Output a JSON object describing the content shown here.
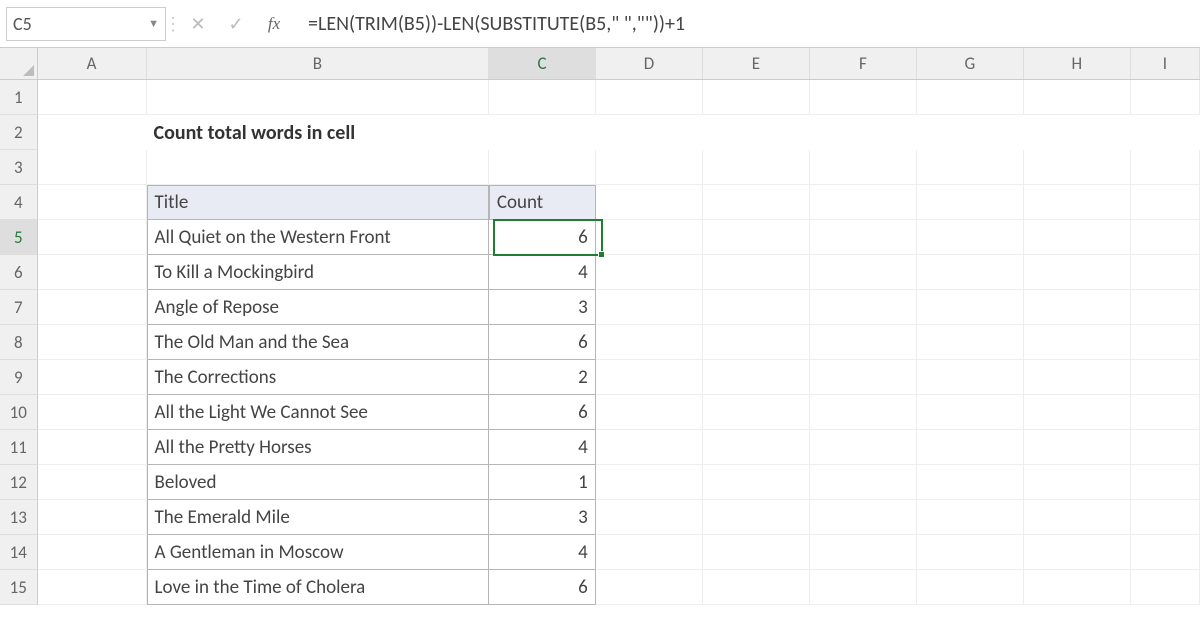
{
  "nameBox": "C5",
  "formula": "=LEN(TRIM(B5))-LEN(SUBSTITUTE(B5,\" \",\"\"))+1",
  "columns": [
    "A",
    "B",
    "C",
    "D",
    "E",
    "F",
    "G",
    "H",
    "I"
  ],
  "activeCol": "C",
  "activeRow": 5,
  "title": "Count total words in cell",
  "headers": {
    "b": "Title",
    "c": "Count"
  },
  "rows": [
    {
      "n": 1
    },
    {
      "n": 2,
      "title": true
    },
    {
      "n": 3
    },
    {
      "n": 4,
      "header": true
    },
    {
      "n": 5,
      "b": "All Quiet on the Western Front",
      "c": "6"
    },
    {
      "n": 6,
      "b": "To Kill a Mockingbird",
      "c": "4"
    },
    {
      "n": 7,
      "b": "Angle of Repose",
      "c": "3"
    },
    {
      "n": 8,
      "b": "The Old Man and the Sea",
      "c": "6"
    },
    {
      "n": 9,
      "b": "The Corrections",
      "c": "2"
    },
    {
      "n": 10,
      "b": "All the Light We Cannot See",
      "c": "6"
    },
    {
      "n": 11,
      "b": "All the Pretty Horses",
      "c": "4"
    },
    {
      "n": 12,
      "b": "Beloved",
      "c": "1"
    },
    {
      "n": 13,
      "b": "The Emerald Mile",
      "c": "3"
    },
    {
      "n": 14,
      "b": "A Gentleman in Moscow",
      "c": "4"
    },
    {
      "n": 15,
      "b": "Love in the Time of Cholera",
      "c": "6"
    }
  ],
  "icons": {
    "cancel": "✕",
    "enter": "✓",
    "fx": "fx",
    "drop": "▼"
  },
  "chart_data": {
    "type": "table",
    "title": "Count total words in cell",
    "columns": [
      "Title",
      "Count"
    ],
    "data": [
      [
        "All Quiet on the Western Front",
        6
      ],
      [
        "To Kill a Mockingbird",
        4
      ],
      [
        "Angle of Repose",
        3
      ],
      [
        "The Old Man and the Sea",
        6
      ],
      [
        "The Corrections",
        2
      ],
      [
        "All the Light We Cannot See",
        6
      ],
      [
        "All the Pretty Horses",
        4
      ],
      [
        "Beloved",
        1
      ],
      [
        "The Emerald Mile",
        3
      ],
      [
        "A Gentleman in Moscow",
        4
      ],
      [
        "Love in the Time of Cholera",
        6
      ]
    ]
  }
}
